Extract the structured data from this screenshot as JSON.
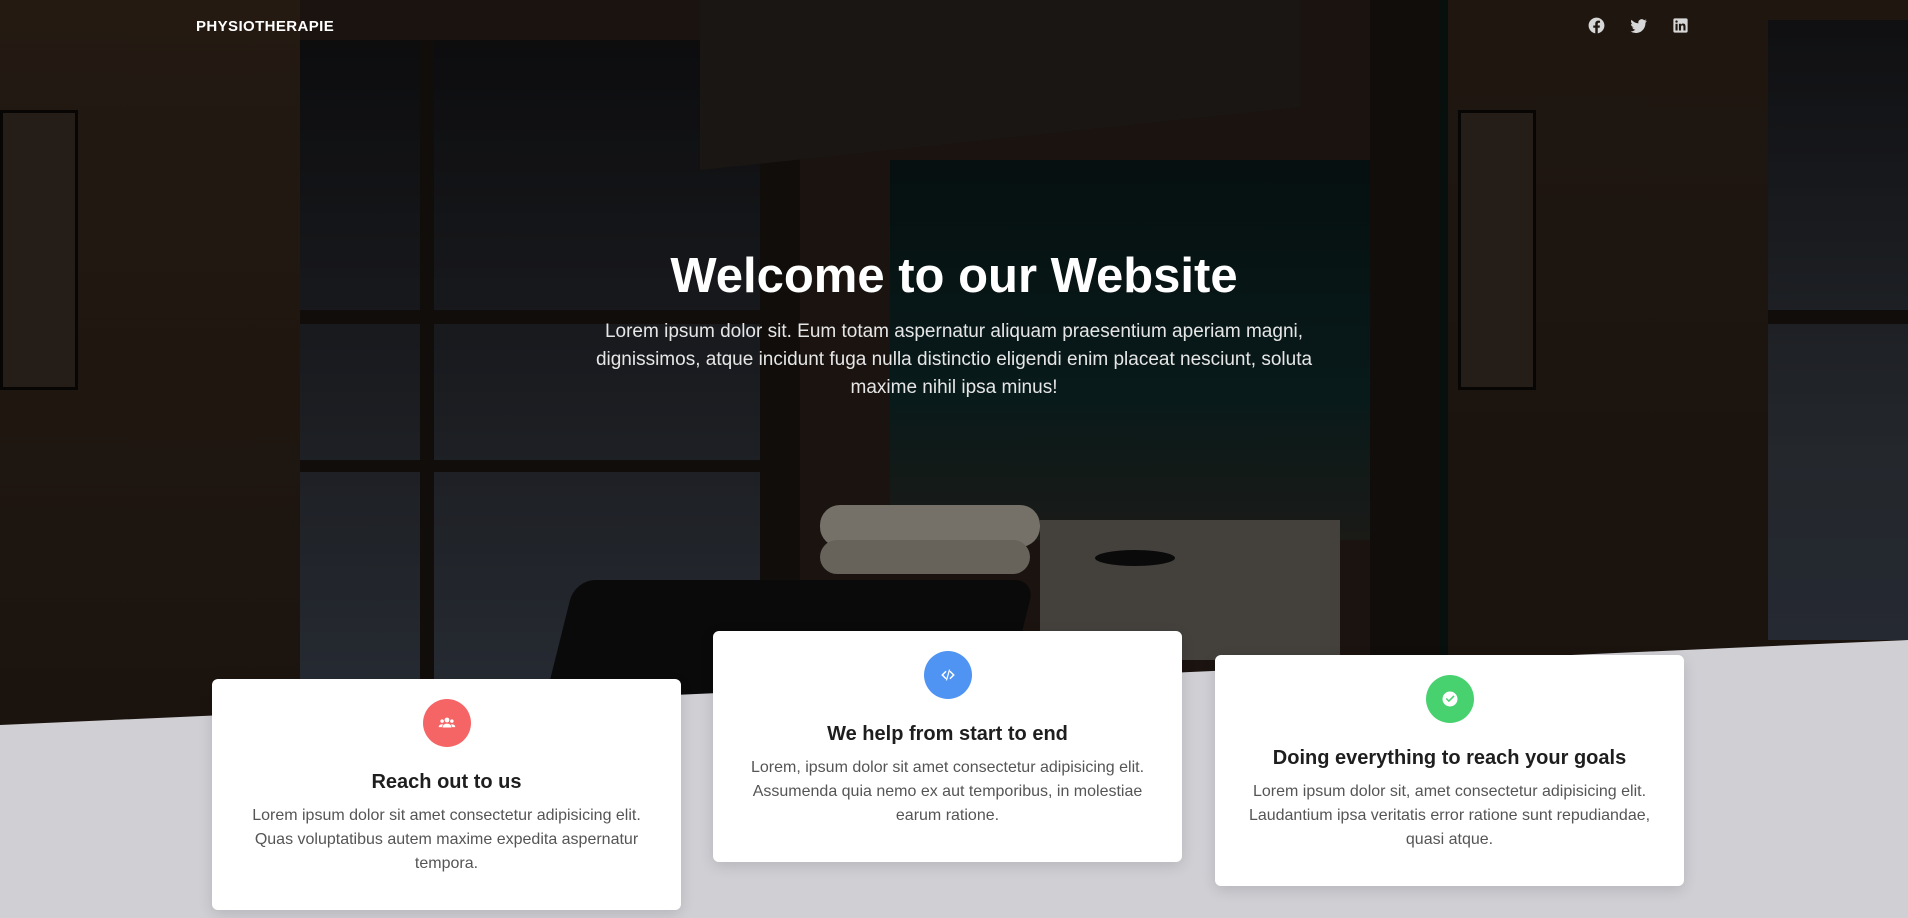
{
  "nav": {
    "brand": "PHYSIOTHERAPIE",
    "social": [
      {
        "icon": "facebook-icon"
      },
      {
        "icon": "twitter-icon"
      },
      {
        "icon": "linkedin-icon"
      }
    ]
  },
  "hero": {
    "title": "Welcome to our Website",
    "subtitle": "Lorem ipsum dolor sit. Eum totam aspernatur aliquam praesentium aperiam magni, dignissimos, atque incidunt fuga nulla distinctio eligendi enim placeat nesciunt, soluta maxime nihil ipsa minus!"
  },
  "cards": [
    {
      "icon": "users-icon",
      "icon_color": "#f56565",
      "title": "Reach out to us",
      "text": "Lorem ipsum dolor sit amet consectetur adipisicing elit. Quas voluptatibus autem maxime expedita aspernatur tempora."
    },
    {
      "icon": "code-icon",
      "icon_color": "#4f94f3",
      "title": "We help from start to end",
      "text": "Lorem, ipsum dolor sit amet consectetur adipisicing elit. Assumenda quia nemo ex aut temporibus, in molestiae earum ratione."
    },
    {
      "icon": "check-circle-icon",
      "icon_color": "#48d16f",
      "title": "Doing everything to reach your goals",
      "text": "Lorem ipsum dolor sit, amet consectetur adipisicing elit. Laudantium ipsa veritatis error ratione sunt repudiandae, quasi atque."
    }
  ]
}
